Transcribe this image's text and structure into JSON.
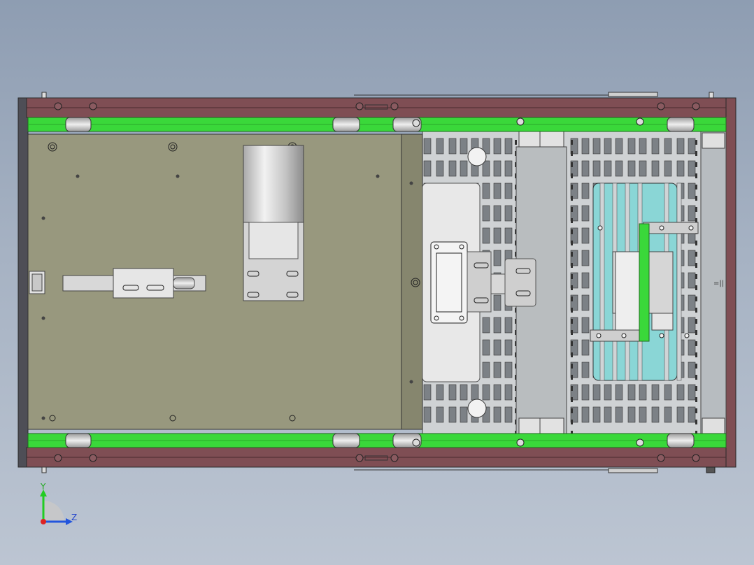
{
  "viewport": {
    "background_top": "#8e9db2",
    "background_bottom": "#bcc5d2"
  },
  "model": {
    "frame_color": "#7f4e54",
    "belt_color": "#3ad83a",
    "plate_color": "#98987e",
    "metal_color": "#d8d8d8",
    "window_color": "#8ad6d6"
  },
  "triad": {
    "y_label": "Y",
    "z_label": "Z",
    "y_color": "#22cc22",
    "z_color": "#2255dd",
    "x_color": "#dd2222"
  }
}
